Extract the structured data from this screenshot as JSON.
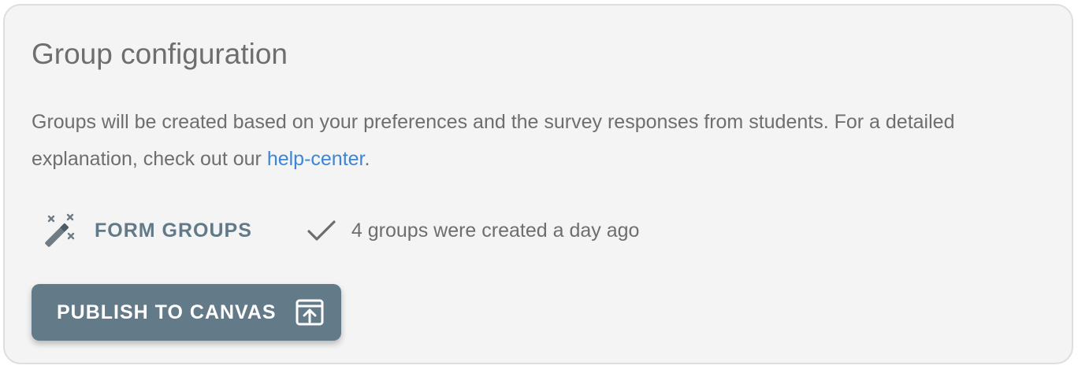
{
  "card": {
    "title": "Group configuration",
    "description_prefix": "Groups will be created based on your preferences and the survey responses from students. For a detailed explanation, check out our ",
    "help_link_label": "help-center",
    "description_suffix": "."
  },
  "actions": {
    "form_groups_label": "FORM GROUPS",
    "form_groups_icon": "magic-wand-icon",
    "status_icon": "checkmark-icon",
    "status_text": "4 groups were created a day ago"
  },
  "publish": {
    "label": "PUBLISH TO CANVAS",
    "icon": "open-in-browser-icon"
  },
  "colors": {
    "card_background": "#f4f4f4",
    "text": "#6e6e6e",
    "link": "#3d85d6",
    "accent": "#637b89",
    "button_text": "#ffffff"
  }
}
